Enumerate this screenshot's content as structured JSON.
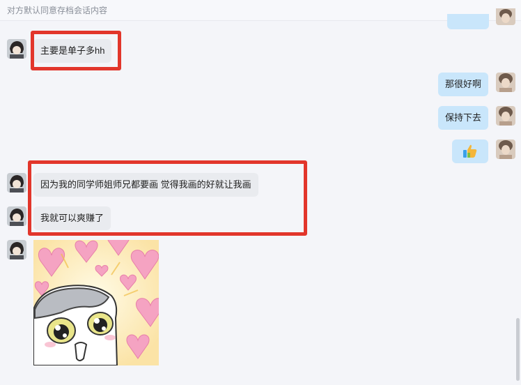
{
  "notice": {
    "text": "对方默认同意存档会话内容"
  },
  "messages": [
    {
      "side": "in",
      "text": "主要是单子多hh"
    },
    {
      "side": "out",
      "text": "那很好啊"
    },
    {
      "side": "out",
      "text": "保持下去"
    },
    {
      "side": "out",
      "content": "thumbs-up-emoji"
    },
    {
      "side": "in",
      "text": "因为我的同学师姐师兄都要画 觉得我画的好就让我画"
    },
    {
      "side": "in",
      "text": "我就可以爽赚了"
    },
    {
      "side": "in",
      "content": "crying-cat-sticker"
    }
  ],
  "colors": {
    "background": "#f4f5f9",
    "incoming_bubble": "#e9ebef",
    "outgoing_bubble": "#c9e6fb",
    "highlight": "#e2362b"
  }
}
